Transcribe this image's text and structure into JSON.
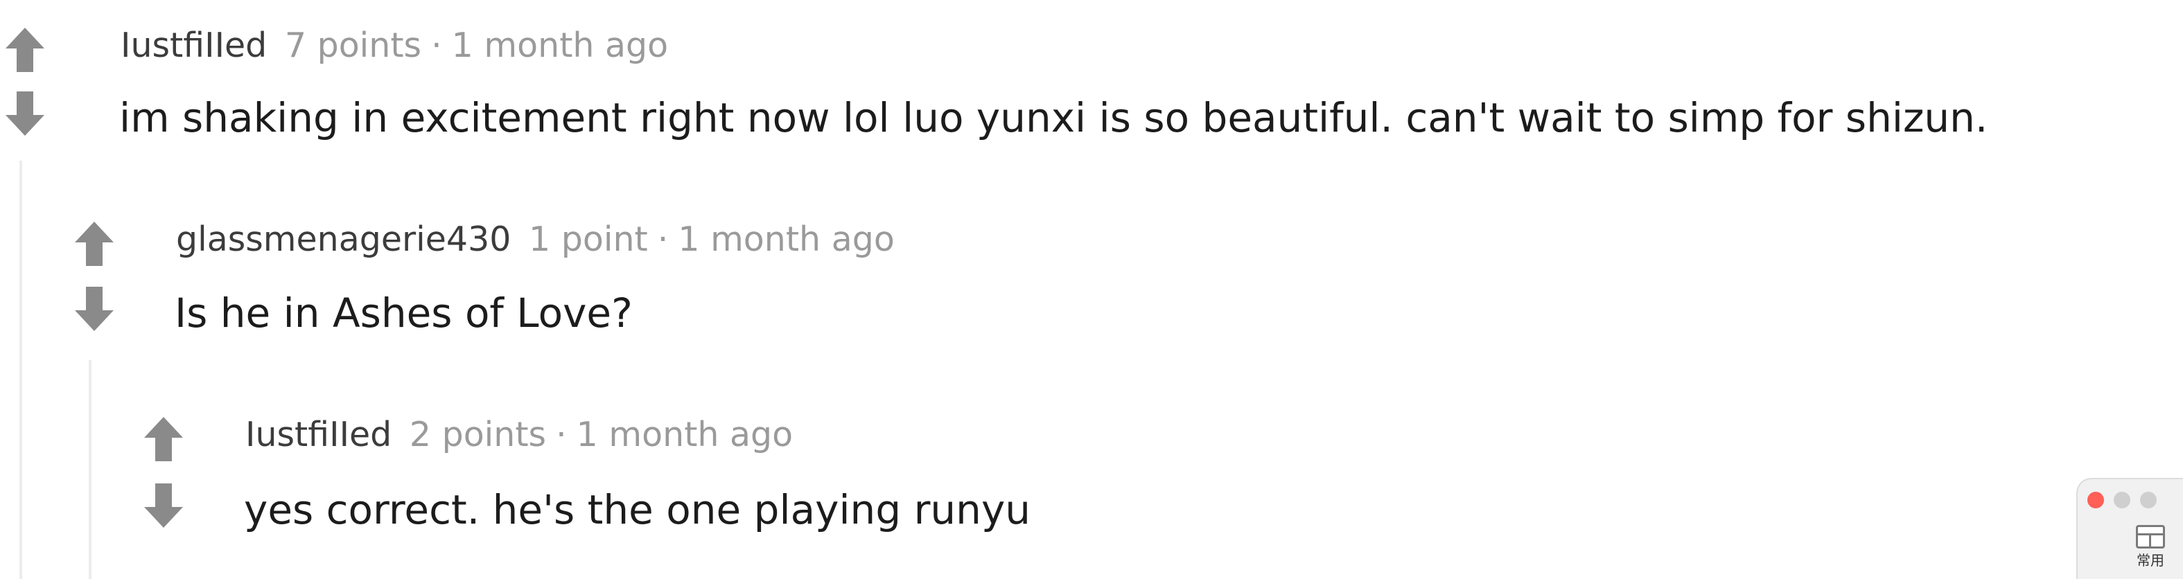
{
  "comments": [
    {
      "author": "IustfiIIed",
      "points": "7 points",
      "separator": "·",
      "time": "1 month ago",
      "body": "im shaking in excitement right now lol luo yunxi is so beautiful. can't wait to simp for shizun."
    },
    {
      "author": "glassmenagerie430",
      "points": "1 point",
      "separator": "·",
      "time": "1 month ago",
      "body": "Is he in Ashes of Love?"
    },
    {
      "author": "IustfiIIed",
      "points": "2 points",
      "separator": "·",
      "time": "1 month ago",
      "body": "yes correct. he's the one playing runyu"
    }
  ],
  "widget": {
    "label": "常用"
  },
  "colors": {
    "vote_arrow": "#8a8a8a",
    "meta_gray": "#9a9a9a",
    "thread_line": "#ececec",
    "close_dot": "#fe5f57"
  },
  "icons": {
    "upvote": "arrow-up-icon",
    "downvote": "arrow-down-icon",
    "widget": "window-icon"
  }
}
